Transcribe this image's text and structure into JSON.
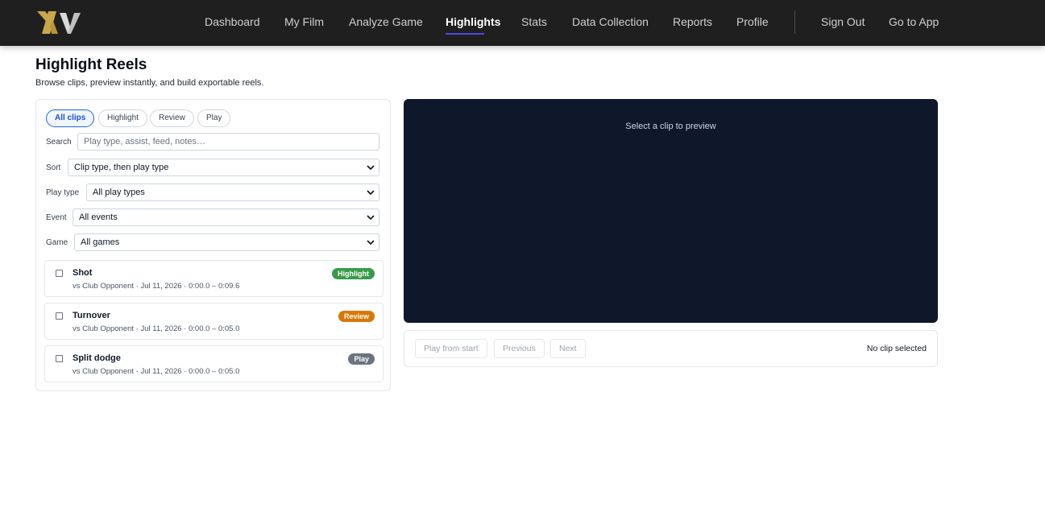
{
  "brand": {
    "logo_text": "XV",
    "gold": "#c9a84c",
    "silver": "#d9d9d9"
  },
  "nav": {
    "items": [
      {
        "label": "Dashboard"
      },
      {
        "label": "My Film"
      },
      {
        "label": "Analyze Game"
      },
      {
        "label": "Highlights"
      },
      {
        "label": "Stats"
      },
      {
        "label": "Data Collection"
      },
      {
        "label": "Reports"
      },
      {
        "label": "Profile"
      }
    ],
    "active": "Highlights",
    "sign_out": "Sign Out",
    "go_to_app": "Go to App",
    "accent": "#4f46e5"
  },
  "page": {
    "title": "Highlight Reels",
    "subtitle": "Browse clips, preview instantly, and build exportable reels."
  },
  "filters": {
    "chips": [
      {
        "label": "All clips",
        "active": true
      },
      {
        "label": "Highlight",
        "active": false
      },
      {
        "label": "Review",
        "active": false
      },
      {
        "label": "Play",
        "active": false
      }
    ],
    "search": {
      "label": "Search",
      "placeholder": "Play type, assist, feed, notes…"
    },
    "sort": {
      "label": "Sort",
      "value": "Clip type, then play type"
    },
    "play_type": {
      "label": "Play type",
      "value": "All play types"
    },
    "event": {
      "label": "Event",
      "value": "All events"
    },
    "game": {
      "label": "Game",
      "value": "All games"
    }
  },
  "clips": [
    {
      "title": "Shot",
      "meta": "vs Club Opponent · Jul 11, 2026 · 0:00.0 – 0:09.6",
      "badge": "Highlight",
      "badge_color": "#3a9a4a"
    },
    {
      "title": "Turnover",
      "meta": "vs Club Opponent · Jul 11, 2026 · 0:00.0 – 0:05.0",
      "badge": "Review",
      "badge_color": "#d97706"
    },
    {
      "title": "Split dodge",
      "meta": "vs Club Opponent · Jul 11, 2026 · 0:00.0 – 0:05.0",
      "badge": "Play",
      "badge_color": "#6b7280"
    }
  ],
  "preview": {
    "empty_text": "Select a clip to preview",
    "background": "#0f172a"
  },
  "controls": {
    "play_from_start": "Play from start",
    "previous": "Previous",
    "next": "Next",
    "status": "No clip selected"
  }
}
